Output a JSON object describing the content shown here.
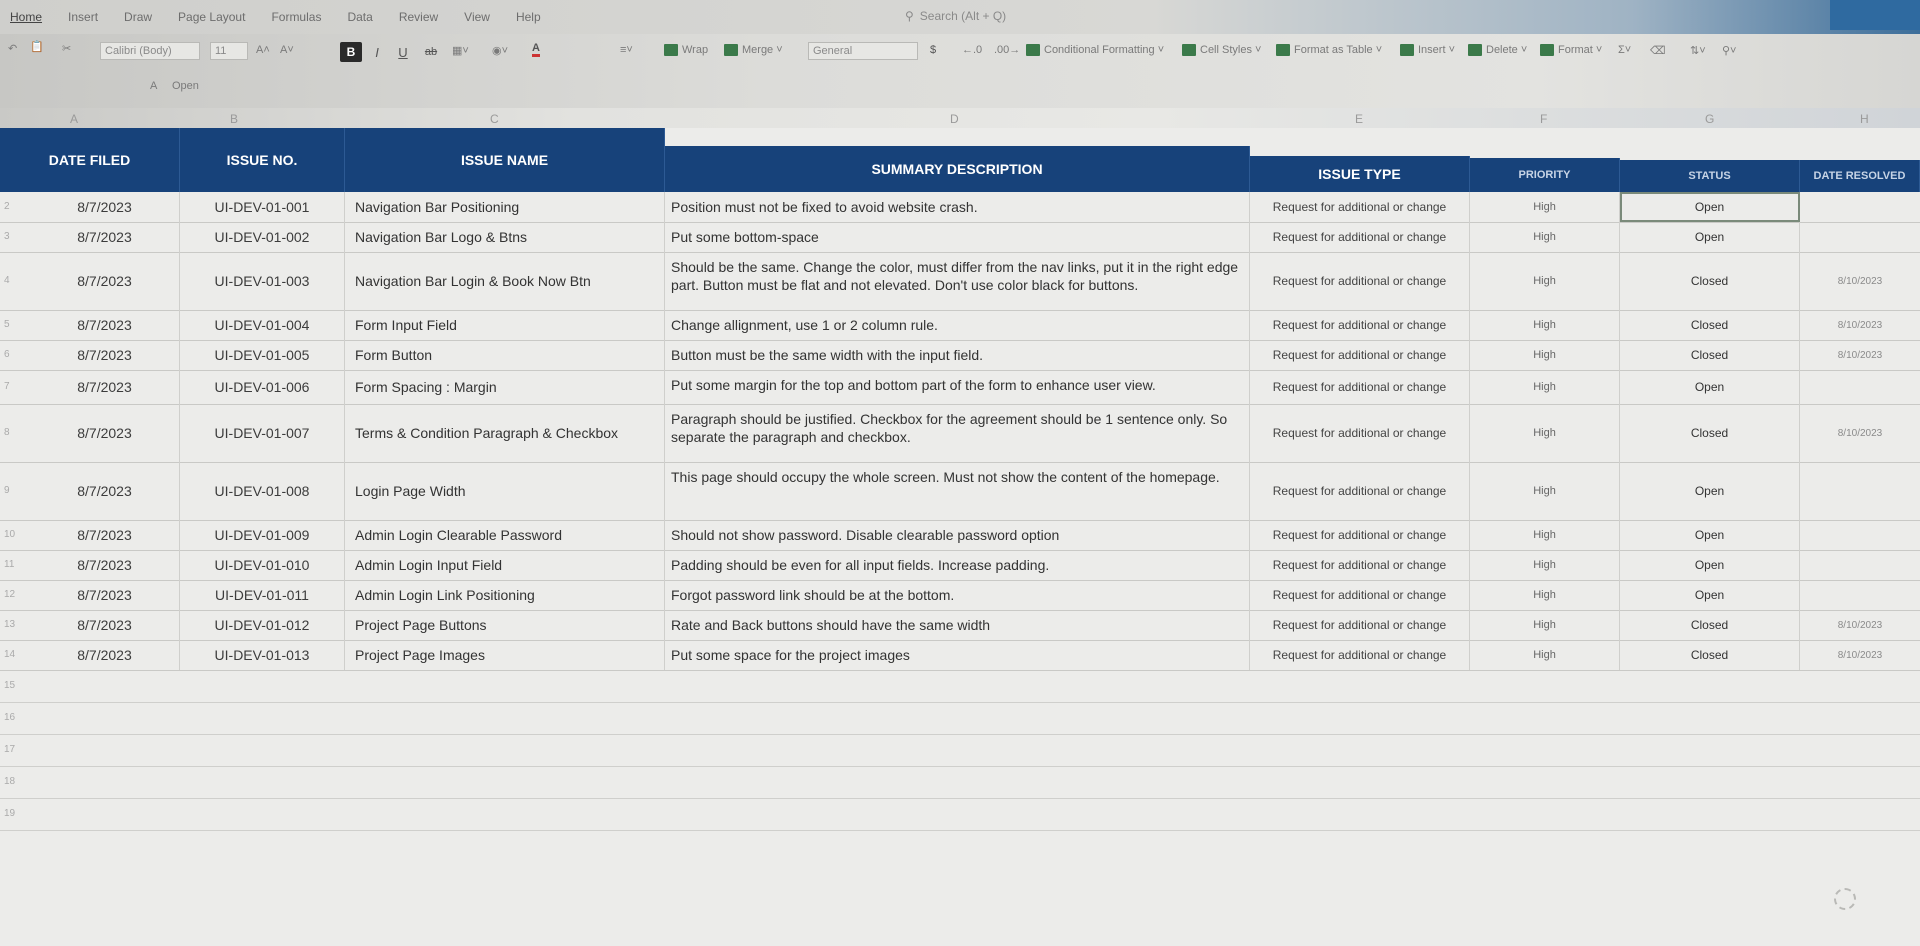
{
  "ribbon": {
    "tabs": [
      "Home",
      "Insert",
      "Draw",
      "Page Layout",
      "Formulas",
      "Data",
      "Review",
      "View",
      "Help"
    ],
    "search_placeholder": "Search (Alt + Q)"
  },
  "toolbar": {
    "font_name": "Calibri (Body)",
    "font_size": "11",
    "bold": "B",
    "italic": "I",
    "underline": "U",
    "strike": "ab",
    "wrap": "Wrap",
    "merge": "Merge",
    "number_format": "General",
    "currency": "$",
    "conditional_formatting": "Conditional Formatting",
    "cell_styles": "Cell Styles",
    "format_as_table": "Format as Table",
    "insert": "Insert",
    "delete": "Delete",
    "format": "Format",
    "name_box": "A",
    "formula_hint": "Open"
  },
  "columns": {
    "letters": [
      "A",
      "B",
      "C",
      "D",
      "E",
      "F",
      "G",
      "H"
    ]
  },
  "headers": {
    "date_filed": "DATE FILED",
    "issue_no": "ISSUE NO.",
    "issue_name": "ISSUE NAME",
    "summary": "SUMMARY DESCRIPTION",
    "issue_type": "ISSUE TYPE",
    "priority": "PRIORITY",
    "status": "STATUS",
    "date_resolved": "DATE RESOLVED"
  },
  "rows": [
    {
      "num": "2",
      "date": "8/7/2023",
      "no": "UI-DEV-01-001",
      "name": "Navigation Bar Positioning",
      "desc": "Position must not be fixed to avoid website crash.",
      "type": "Request for additional or change",
      "priority": "High",
      "status": "Open",
      "resolved": ""
    },
    {
      "num": "3",
      "date": "8/7/2023",
      "no": "UI-DEV-01-002",
      "name": "Navigation Bar Logo & Btns",
      "desc": "Put some bottom-space",
      "type": "Request for additional or change",
      "priority": "High",
      "status": "Open",
      "resolved": ""
    },
    {
      "num": "4",
      "date": "8/7/2023",
      "no": "UI-DEV-01-003",
      "name": "Navigation Bar Login & Book Now Btn",
      "desc": "Should be the same. Change the color, must differ from the nav links, put it in the right edge part. Button must be flat and not elevated. Don't use  color black for buttons.",
      "type": "Request for additional or change",
      "priority": "High",
      "status": "Closed",
      "resolved": "8/10/2023"
    },
    {
      "num": "5",
      "date": "8/7/2023",
      "no": "UI-DEV-01-004",
      "name": "Form Input Field",
      "desc": "Change allignment, use 1 or 2 column rule.",
      "type": "Request for additional or change",
      "priority": "High",
      "status": "Closed",
      "resolved": "8/10/2023"
    },
    {
      "num": "6",
      "date": "8/7/2023",
      "no": "UI-DEV-01-005",
      "name": "Form Button",
      "desc": "Button must be the same width with the input field.",
      "type": "Request for additional or change",
      "priority": "High",
      "status": "Closed",
      "resolved": "8/10/2023"
    },
    {
      "num": "7",
      "date": "8/7/2023",
      "no": "UI-DEV-01-006",
      "name": "Form Spacing : Margin",
      "desc": "Put some margin for the top and bottom part of the form to enhance user view.",
      "type": "Request for additional or change",
      "priority": "High",
      "status": "Open",
      "resolved": ""
    },
    {
      "num": "8",
      "date": "8/7/2023",
      "no": "UI-DEV-01-007",
      "name": "Terms & Condition Paragraph & Checkbox",
      "desc": "Paragraph should be justified. Checkbox for the agreement should be 1 sentence only. So separate the paragraph and checkbox.",
      "type": "Request for additional or change",
      "priority": "High",
      "status": "Closed",
      "resolved": "8/10/2023"
    },
    {
      "num": "9",
      "date": "8/7/2023",
      "no": "UI-DEV-01-008",
      "name": "Login Page Width",
      "desc": "This page should occupy the whole screen. Must not show the content of the homepage.",
      "type": "Request for additional or change",
      "priority": "High",
      "status": "Open",
      "resolved": ""
    },
    {
      "num": "10",
      "date": "8/7/2023",
      "no": "UI-DEV-01-009",
      "name": "Admin Login Clearable Password",
      "desc": "Should not show password. Disable clearable password option",
      "type": "Request for additional or change",
      "priority": "High",
      "status": "Open",
      "resolved": ""
    },
    {
      "num": "11",
      "date": "8/7/2023",
      "no": "UI-DEV-01-010",
      "name": "Admin Login Input Field",
      "desc": "Padding should be even for all input fields. Increase padding.",
      "type": "Request for additional or change",
      "priority": "High",
      "status": "Open",
      "resolved": ""
    },
    {
      "num": "12",
      "date": "8/7/2023",
      "no": "UI-DEV-01-011",
      "name": "Admin Login Link Positioning",
      "desc": "Forgot password link should be at the bottom.",
      "type": "Request for additional or change",
      "priority": "High",
      "status": "Open",
      "resolved": ""
    },
    {
      "num": "13",
      "date": "8/7/2023",
      "no": "UI-DEV-01-012",
      "name": "Project Page Buttons",
      "desc": "Rate and Back buttons should have the same width",
      "type": "Request for additional or change",
      "priority": "High",
      "status": "Closed",
      "resolved": "8/10/2023"
    },
    {
      "num": "14",
      "date": "8/7/2023",
      "no": "UI-DEV-01-013",
      "name": "Project Page Images",
      "desc": "Put some space for the project images",
      "type": "Request for additional or change",
      "priority": "High",
      "status": "Closed",
      "resolved": "8/10/2023"
    }
  ],
  "empty_rows": [
    "15",
    "16",
    "17",
    "18",
    "19"
  ]
}
